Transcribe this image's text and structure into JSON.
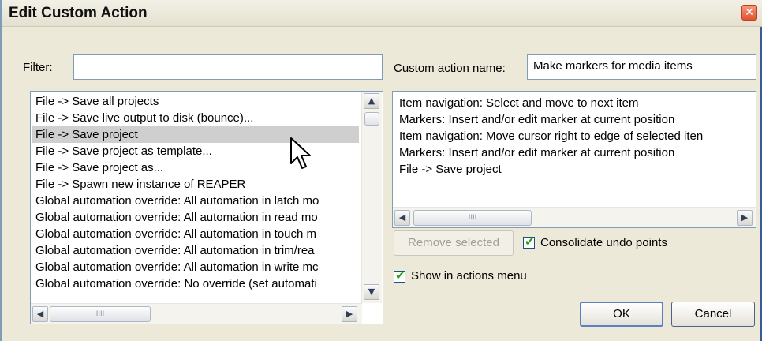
{
  "window": {
    "title": "Edit Custom Action",
    "close_glyph": "✕"
  },
  "filter": {
    "label": "Filter:",
    "value": ""
  },
  "custom_name": {
    "label": "Custom action name:",
    "value": "Make markers for media items"
  },
  "actions_list": {
    "items": [
      "File -> Save all projects",
      "File -> Save live output to disk (bounce)...",
      "File -> Save project",
      "File -> Save project as template...",
      "File -> Save project as...",
      "File -> Spawn new instance of REAPER",
      "Global automation override: All automation in latch mo",
      "Global automation override: All automation in read mo",
      "Global automation override: All automation in touch m",
      "Global automation override: All automation in trim/rea",
      "Global automation override: All automation in write mc",
      "Global automation override: No override (set automati"
    ],
    "selected_index": 2
  },
  "custom_actions": {
    "items": [
      "Item navigation: Select and move to next item",
      "Markers: Insert and/or edit marker at current position",
      "Item navigation: Move cursor right to edge of selected iten",
      "Markers: Insert and/or edit marker at current position",
      "File -> Save project"
    ]
  },
  "scroll": {
    "left_arrow": "◀",
    "right_arrow": "▶",
    "up_arrow": "▲",
    "down_arrow": "▼",
    "thumb_grip": "IIII"
  },
  "buttons": {
    "remove_selected": "Remove selected",
    "ok": "OK",
    "cancel": "Cancel"
  },
  "options": {
    "consolidate_undo": {
      "label": "Consolidate undo points",
      "checked": true
    },
    "show_in_menu": {
      "label": "Show in actions menu",
      "checked": true
    },
    "check_glyph": "✔"
  },
  "icons": {
    "cursor": "arrow-pointer-icon"
  }
}
